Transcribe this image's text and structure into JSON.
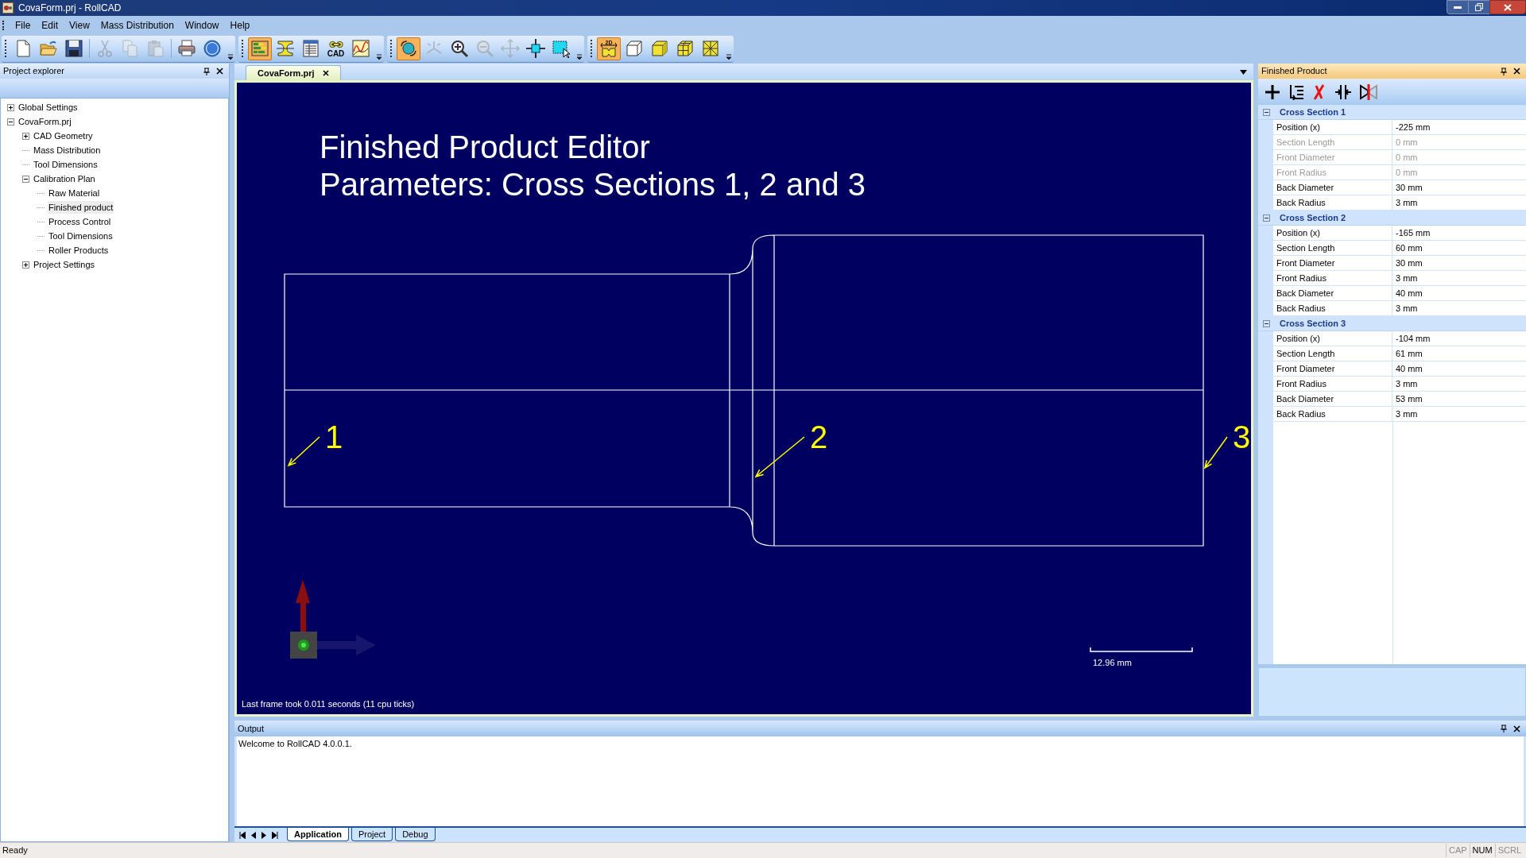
{
  "window": {
    "title": "CovaForm.prj - RollCAD"
  },
  "menu": [
    "File",
    "Edit",
    "View",
    "Mass Distribution",
    "Window",
    "Help"
  ],
  "toolbar": [
    [
      {
        "kind": "new",
        "selected": false,
        "disabled": false
      },
      {
        "kind": "open",
        "selected": false,
        "disabled": false
      },
      {
        "kind": "save",
        "selected": false,
        "disabled": false
      },
      {
        "kind": "sep"
      },
      {
        "kind": "cut",
        "selected": false,
        "disabled": true
      },
      {
        "kind": "copy",
        "selected": false,
        "disabled": true
      },
      {
        "kind": "paste",
        "selected": false,
        "disabled": true
      },
      {
        "kind": "sep"
      },
      {
        "kind": "print",
        "selected": false,
        "disabled": false
      },
      {
        "kind": "help",
        "selected": false,
        "disabled": false
      }
    ],
    [
      {
        "kind": "plan",
        "selected": true,
        "disabled": false
      },
      {
        "kind": "profile",
        "selected": false,
        "disabled": false
      },
      {
        "kind": "table",
        "selected": false,
        "disabled": false
      },
      {
        "kind": "cad",
        "label": "CAD",
        "selected": false,
        "disabled": false
      },
      {
        "kind": "graph",
        "selected": false,
        "disabled": false
      }
    ],
    [
      {
        "kind": "rotate",
        "selected": true,
        "disabled": false
      },
      {
        "kind": "pan3d",
        "selected": false,
        "disabled": true
      },
      {
        "kind": "zoomin",
        "selected": false,
        "disabled": false
      },
      {
        "kind": "zoomout",
        "selected": false,
        "disabled": true
      },
      {
        "kind": "move",
        "selected": false,
        "disabled": true
      },
      {
        "kind": "fit",
        "selected": false,
        "disabled": false
      },
      {
        "kind": "zoomwin",
        "selected": false,
        "disabled": false
      }
    ],
    [
      {
        "kind": "view2d",
        "label": "2D",
        "selected": true,
        "disabled": false
      },
      {
        "kind": "cube_wire",
        "selected": false,
        "disabled": false
      },
      {
        "kind": "cube_solid",
        "selected": false,
        "disabled": false
      },
      {
        "kind": "cube_grid",
        "selected": false,
        "disabled": false
      },
      {
        "kind": "cube_cross",
        "selected": false,
        "disabled": false
      }
    ]
  ],
  "project_explorer": {
    "title": "Project explorer",
    "tree": [
      {
        "label": "Global Settings",
        "expanded": false,
        "selected": false
      },
      {
        "label": "CovaForm.prj",
        "expanded": true,
        "selected": false,
        "children": [
          {
            "label": "CAD Geometry",
            "expanded": false,
            "selected": false
          },
          {
            "label": "Mass Distribution",
            "selected": false
          },
          {
            "label": "Tool Dimensions",
            "selected": false
          },
          {
            "label": "Calibration Plan",
            "expanded": true,
            "selected": false,
            "children": [
              {
                "label": "Raw Material",
                "selected": false
              },
              {
                "label": "Finished product",
                "selected": true
              },
              {
                "label": "Process Control",
                "selected": false
              },
              {
                "label": "Tool Dimensions",
                "selected": false
              },
              {
                "label": "Roller Products",
                "selected": false
              }
            ]
          },
          {
            "label": "Project Settings",
            "expanded": false,
            "selected": false
          }
        ]
      }
    ]
  },
  "document_tabs": [
    {
      "label": "CovaForm.prj",
      "selected": true
    }
  ],
  "canvas": {
    "title_lines": [
      "Finished Product Editor",
      "Parameters: Cross Sections 1, 2 and 3"
    ],
    "callouts": [
      "1",
      "2",
      "3"
    ],
    "scale_label": "12.96 mm",
    "frame_info": "Last frame took 0.011 seconds (11 cpu ticks)"
  },
  "properties": {
    "title": "Finished Product",
    "sections": [
      {
        "name": "Cross Section 1",
        "expanded": true,
        "rows": [
          {
            "label": "Position (x)",
            "value": "-225 mm",
            "disabled": false
          },
          {
            "label": "Section Length",
            "value": "0 mm",
            "disabled": true
          },
          {
            "label": "Front Diameter",
            "value": "0 mm",
            "disabled": true
          },
          {
            "label": "Front Radius",
            "value": "0 mm",
            "disabled": true
          },
          {
            "label": "Back Diameter",
            "value": "30 mm",
            "disabled": false
          },
          {
            "label": "Back Radius",
            "value": "3 mm",
            "disabled": false
          }
        ]
      },
      {
        "name": "Cross Section 2",
        "expanded": true,
        "rows": [
          {
            "label": "Position (x)",
            "value": "-165 mm",
            "disabled": false
          },
          {
            "label": "Section Length",
            "value": "60 mm",
            "disabled": false
          },
          {
            "label": "Front Diameter",
            "value": "30 mm",
            "disabled": false
          },
          {
            "label": "Front Radius",
            "value": "3 mm",
            "disabled": false
          },
          {
            "label": "Back Diameter",
            "value": "40 mm",
            "disabled": false
          },
          {
            "label": "Back Radius",
            "value": "3 mm",
            "disabled": false
          }
        ]
      },
      {
        "name": "Cross Section 3",
        "expanded": true,
        "rows": [
          {
            "label": "Position (x)",
            "value": "-104 mm",
            "disabled": false
          },
          {
            "label": "Section Length",
            "value": "61 mm",
            "disabled": false
          },
          {
            "label": "Front Diameter",
            "value": "40 mm",
            "disabled": false
          },
          {
            "label": "Front Radius",
            "value": "3 mm",
            "disabled": false
          },
          {
            "label": "Back Diameter",
            "value": "53 mm",
            "disabled": false
          },
          {
            "label": "Back Radius",
            "value": "3 mm",
            "disabled": false
          }
        ]
      }
    ]
  },
  "output": {
    "title": "Output",
    "lines": [
      "Welcome to RollCAD 4.0.0.1."
    ],
    "tabs": [
      {
        "label": "Application",
        "selected": true
      },
      {
        "label": "Project",
        "selected": false
      },
      {
        "label": "Debug",
        "selected": false
      }
    ]
  },
  "status_bar": {
    "text": "Ready",
    "indicators": [
      {
        "label": "CAP",
        "on": false
      },
      {
        "label": "NUM",
        "on": true
      },
      {
        "label": "SCRL",
        "on": false
      }
    ]
  }
}
